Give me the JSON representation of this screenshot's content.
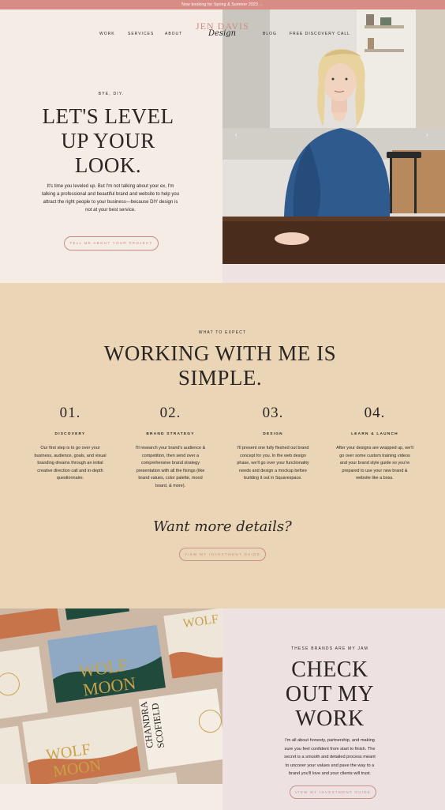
{
  "announcement": "Now booking for Spring & Summer 2023 →",
  "nav": {
    "work": "WORK",
    "services": "SERVICES",
    "about": "ABOUT",
    "blog": "BLOG",
    "free_call": "FREE DISCOVERY CALL"
  },
  "logo": {
    "main": "JEN DAVIS",
    "script": "Design"
  },
  "hero": {
    "eyebrow": "BYE, DIY.",
    "heading_line1": "LET'S LEVEL",
    "heading_line2": "UP YOUR",
    "heading_line3": "LOOK.",
    "body_line1": "It's time you leveled up. But I'm not talking about your ex, I'm",
    "body_line2": "talking a professional and beautiful brand and website to help you",
    "body_line3": "attract the right people to your business—because DIY design is",
    "body_line4": "not at your best service.",
    "cta": "TELL ME ABOUT YOUR PROJECT"
  },
  "process": {
    "eyebrow": "WHAT TO EXPECT",
    "heading_line1": "WORKING WITH ME IS",
    "heading_line2": "SIMPLE.",
    "steps": [
      {
        "num": "01.",
        "title": "DISCOVERY",
        "d1": "Our first step is to go over your",
        "d2": "business, audience, goals, and visual",
        "d3": "branding dreams through an initial",
        "d4": "creative direction call and in-depth",
        "d5": "questionnaire.",
        "d6": ""
      },
      {
        "num": "02.",
        "title": "BRAND STRATEGY",
        "d1": "I'll research your brand's audience &",
        "d2": "competition, then send over a",
        "d3": "comprehensive brand strategy",
        "d4": "presentation with all the fixings (like",
        "d5": "brand values, color palette, mood",
        "d6": "board, & more)."
      },
      {
        "num": "03.",
        "title": "DESIGN",
        "d1": "I'll present one fully fleshed out brand",
        "d2": "concept for you. In the web design",
        "d3": "phase, we'll go over your functionality",
        "d4": "needs and design a mockup before",
        "d5": "building it out in Squarespace.",
        "d6": ""
      },
      {
        "num": "04.",
        "title": "LEARN & LAUNCH",
        "d1": "After your designs are wrapped up, we'll",
        "d2": "go over some custom training videos",
        "d3": "and your brand style guide so you're",
        "d4": "prepared to use your new brand &",
        "d5": "website like a boss.",
        "d6": ""
      }
    ],
    "script": "Want more details?",
    "cta": "VIEW MY INVESTMENT GUIDE"
  },
  "work": {
    "eyebrow": "THESE BRANDS ARE MY JAM",
    "heading_line1": "CHECK",
    "heading_line2": "OUT MY",
    "heading_line3": "WORK",
    "body_line1": "I'm all about honesty, partnership, and making",
    "body_line2": "sure you feel confident from start to finish. The",
    "body_line3": "secret is a smooth and detailed process meant",
    "body_line4": "to uncover your values and pave the way to a",
    "body_line5": "brand you'll love and your clients will trust.",
    "cta": "VIEW MY INVESTMENT GUIDE",
    "mockup": {
      "wolf": "WOLF",
      "moon": "MOON",
      "name1": "CHANDRA",
      "name2": "SCOFIELD",
      "seal": "WOLF"
    }
  },
  "colors": {
    "accent": "#d88c86",
    "cream": "#f6ece6",
    "tan": "#ead6b7",
    "blush": "#ede1e2",
    "ink": "#2b2523",
    "forest": "#1f4a3c",
    "terracotta": "#c7744a",
    "gold": "#c9a24a"
  },
  "icons": {
    "prev": "chevron-left-icon",
    "next": "chevron-right-icon"
  }
}
